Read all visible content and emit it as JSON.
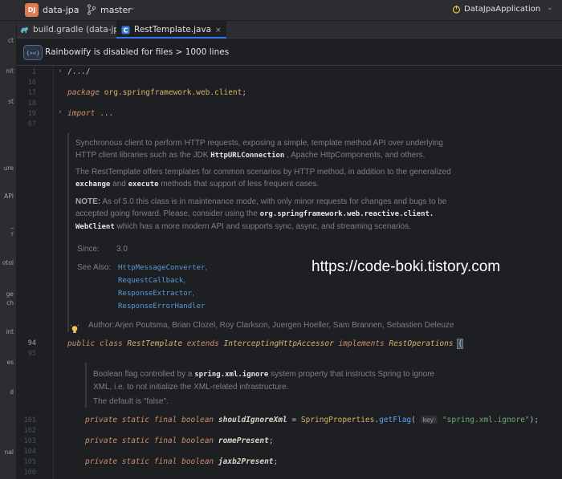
{
  "topbar": {
    "project_badge": "DJ",
    "project_name": "data-jpa",
    "branch_name": "master",
    "run_config": "DataJpaApplication",
    "accent_color": "#e07a52",
    "run_color": "#e0c84a"
  },
  "left_panel": {
    "fragments": [
      "ct",
      "nit",
      "st",
      "ure",
      "API",
      "_",
      "r",
      "otol",
      "ge",
      "ch",
      "int",
      "es",
      "d",
      "nal"
    ]
  },
  "tabs": [
    {
      "label": "build.gradle (data-jpa)",
      "icon": "gradle-icon",
      "active": false
    },
    {
      "label": "RestTemplate.java",
      "icon": "java-file-icon",
      "active": true,
      "close": "×"
    }
  ],
  "notice": {
    "text": "Rainbowify is disabled for files > 1000 lines"
  },
  "gutter": {
    "lines": [
      "1",
      "16",
      "17",
      "18",
      "19",
      "67",
      "94",
      "95",
      "101",
      "102",
      "103",
      "104",
      "105",
      "106"
    ],
    "current_line": "94"
  },
  "code": {
    "fold_comment": "/.../",
    "package_kw": "package",
    "package_name": "org.springframework.web.client",
    "semicolon": ";",
    "import_kw": "import",
    "import_ellipsis": "...",
    "class_decl": {
      "public": "public",
      "class": "class",
      "name": "RestTemplate",
      "extends": "extends",
      "super": "InterceptingHttpAccessor",
      "implements": "implements",
      "iface": "RestOperations",
      "brace": "{"
    },
    "field1": {
      "mods": "private static final boolean",
      "name": "shouldIgnoreXml",
      "eq": " = ",
      "cls": "SpringProperties",
      "dot": ".",
      "method": "getFlag",
      "open": "(",
      "hint": "key:",
      "str": "\"spring.xml.ignore\"",
      "close": ");"
    },
    "field2": {
      "mods": "private static final boolean",
      "name": "romePresent",
      "semi": ";"
    },
    "field3": {
      "mods": "private static final boolean",
      "name": "jaxb2Present",
      "semi": ";"
    }
  },
  "javadoc_class": {
    "p1_l1": "Synchronous client to perform HTTP requests, exposing a simple, template method API over underlying",
    "p1_l2a": "HTTP client libraries such as the JDK",
    "p1_l2b": "HttpURLConnection",
    "p1_l2c": ", Apache HttpComponents, and others.",
    "p2_l1": "The RestTemplate offers templates for common scenarios by HTTP method, in addition to the generalized",
    "p2_l2a": "exchange",
    "p2_l2b": "and",
    "p2_l2c": "execute",
    "p2_l2d": "methods that support of less frequent cases.",
    "p3_label": "NOTE:",
    "p3_l1": "As of 5.0 this class is in maintenance mode, with only minor requests for changes and bugs to be",
    "p3_l2a": "accepted going forward. Please, consider using the",
    "p3_l2b": "org.springframework.web.reactive.client.",
    "p3_l3a": "WebClient",
    "p3_l3b": "which has a more modern API and supports sync, async, and streaming scenarios.",
    "since_label": "Since:",
    "since_value": "3.0",
    "see_also_label": "See Also:",
    "see_also": [
      "HttpMessageConverter",
      "RequestCallback",
      "ResponseExtractor",
      "ResponseErrorHandler"
    ],
    "see_sep": ",",
    "author_label": "Author:",
    "authors": "Arjen Poutsma, Brian Clozel, Roy Clarkson, Juergen Hoeller, Sam Brannen, Sebastien Deleuze"
  },
  "javadoc_field": {
    "l1a": "Boolean flag controlled by a",
    "l1b": "spring.xml.ignore",
    "l1c": "system property that instructs Spring to ignore",
    "l2": "XML, i.e. to not initialize the XML-related infrastructure.",
    "l3": "The default is \"false\"."
  },
  "watermark": "https://code-boki.tistory.com"
}
